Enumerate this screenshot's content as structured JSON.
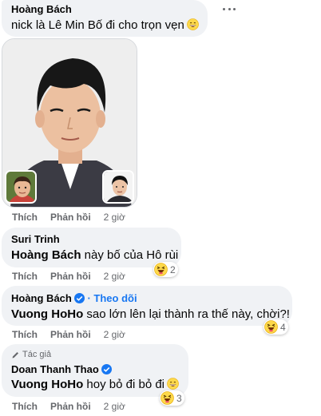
{
  "comment1": {
    "name": "Hoàng Bách",
    "text": "nick là Lê Min Bố đi cho trọn vẹn",
    "emoji": "grinning-face-icon",
    "action_like": "Thích",
    "action_reply": "Phản hồi",
    "time": "2 giờ"
  },
  "comment2": {
    "name": "Suri Trinh",
    "mention": "Hoàng Bách",
    "text": " này bố của Hô rùi",
    "reaction_count": "2",
    "action_like": "Thích",
    "action_reply": "Phản hồi",
    "time": "2 giờ"
  },
  "comment3": {
    "name": "Hoàng Bách",
    "follow": "· Theo dõi",
    "mention": "Vuong HoHo",
    "text": " sao lớn lên lại thành ra thế này, chời?!",
    "reaction_count": "4",
    "action_like": "Thích",
    "action_reply": "Phản hồi",
    "time": "2 giờ"
  },
  "comment4": {
    "author_label": "Tác giả",
    "name": "Doan Thanh Thao",
    "mention": "Vuong HoHo",
    "text": " hoy bỏ đi bỏ đi",
    "reaction_count": "3",
    "action_like": "Thích",
    "action_reply": "Phản hồi",
    "time": "2 giờ"
  },
  "colors": {
    "bubble": "#f0f2f5",
    "meta": "#65676b",
    "accent": "#1877f2",
    "emoji": "#fdd94b"
  }
}
